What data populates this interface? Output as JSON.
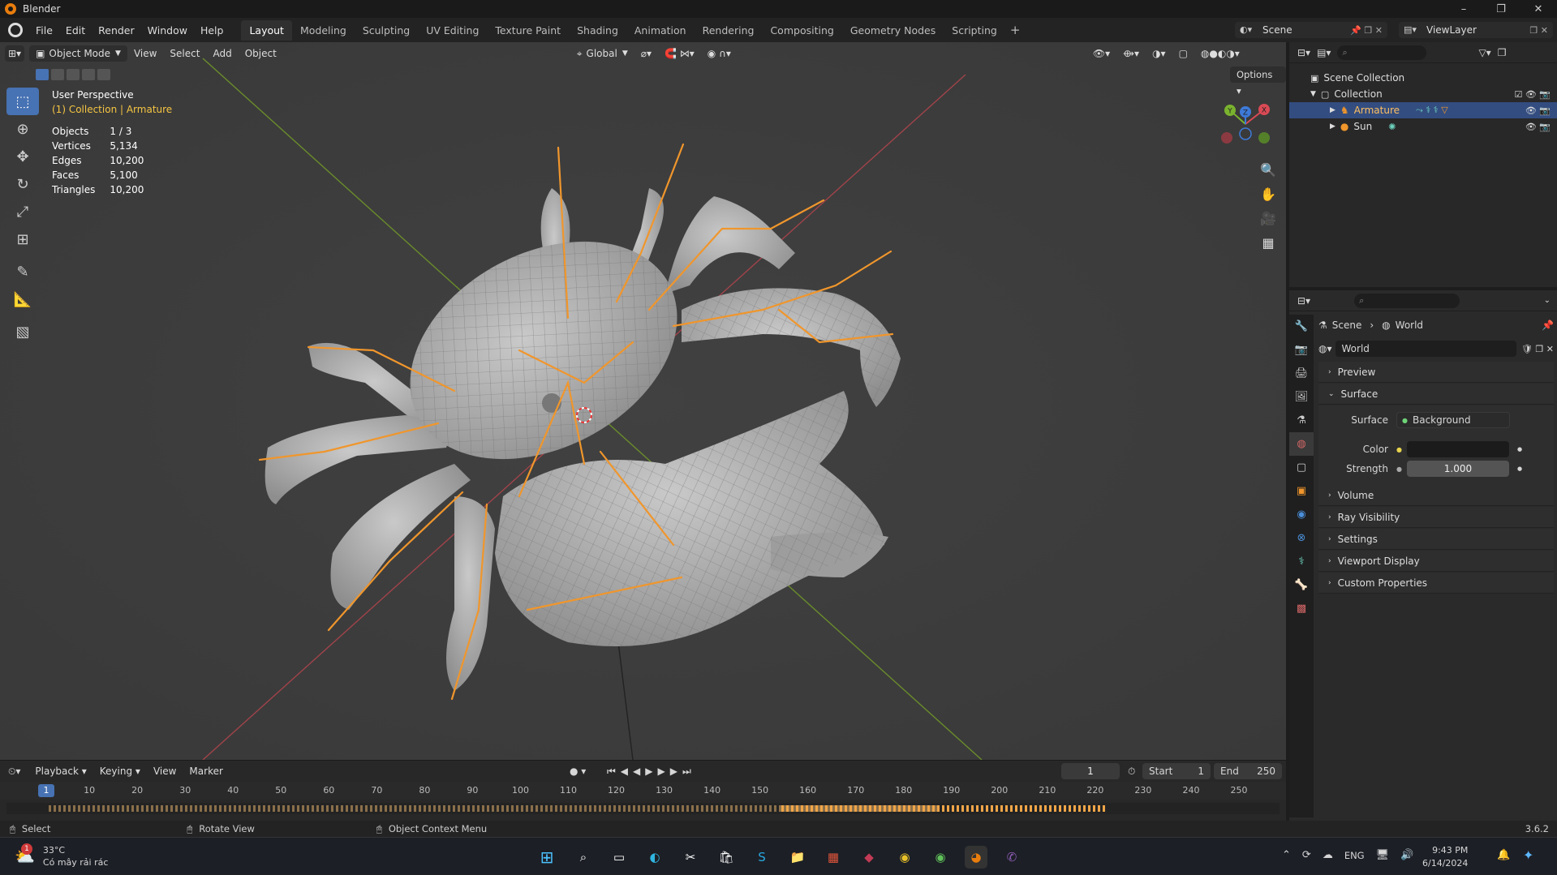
{
  "window": {
    "title": "Blender",
    "controls": [
      "–",
      "❐",
      "✕"
    ]
  },
  "menubar": {
    "menus": [
      "File",
      "Edit",
      "Render",
      "Window",
      "Help"
    ],
    "tabs": [
      "Layout",
      "Modeling",
      "Sculpting",
      "UV Editing",
      "Texture Paint",
      "Shading",
      "Animation",
      "Rendering",
      "Compositing",
      "Geometry Nodes",
      "Scripting"
    ],
    "active_tab": "Layout",
    "add_tab": "+",
    "scene": "Scene",
    "view_layer": "ViewLayer"
  },
  "viewport": {
    "mode": "Object Mode",
    "menus": [
      "View",
      "Select",
      "Add",
      "Object"
    ],
    "orientation": "Global",
    "options": "Options",
    "perspective_label": "User Perspective",
    "collection_label": "(1) Collection | Armature",
    "stats": [
      {
        "label": "Objects",
        "value": "1 / 3"
      },
      {
        "label": "Vertices",
        "value": "5,134"
      },
      {
        "label": "Edges",
        "value": "10,200"
      },
      {
        "label": "Faces",
        "value": "5,100"
      },
      {
        "label": "Triangles",
        "value": "10,200"
      }
    ],
    "gizmo_axes": {
      "x": "X",
      "y": "Y",
      "z": "Z"
    }
  },
  "outliner": {
    "scene_collection": "Scene Collection",
    "collection": "Collection",
    "items": [
      "Armature",
      "Sun"
    ]
  },
  "properties": {
    "breadcrumb_scene": "Scene",
    "breadcrumb_world": "World",
    "world_name": "World",
    "panels": {
      "preview": "Preview",
      "surface": "Surface",
      "volume": "Volume",
      "ray_visibility": "Ray Visibility",
      "settings": "Settings",
      "viewport_display": "Viewport Display",
      "custom_properties": "Custom Properties"
    },
    "surface_label": "Surface",
    "surface_value": "Background",
    "color_label": "Color",
    "strength_label": "Strength",
    "strength_value": "1.000"
  },
  "timeline": {
    "menus": [
      "Playback",
      "Keying",
      "View",
      "Marker"
    ],
    "current_frame": "1",
    "start_label": "Start",
    "start_value": "1",
    "end_label": "End",
    "end_value": "250",
    "ticks": [
      "10",
      "20",
      "30",
      "40",
      "50",
      "60",
      "70",
      "80",
      "90",
      "100",
      "110",
      "120",
      "130",
      "140",
      "150",
      "160",
      "170",
      "180",
      "190",
      "200",
      "210",
      "220",
      "230",
      "240",
      "250"
    ],
    "playhead_label": "1"
  },
  "statusbar": {
    "select": "Select",
    "rotate": "Rotate View",
    "context": "Object Context Menu",
    "version": "3.6.2"
  },
  "taskbar": {
    "weather_temp": "33°C",
    "weather_desc": "Có mây rải rác",
    "badge": "1",
    "lang": "ENG",
    "time": "9:43 PM",
    "date": "6/14/2024"
  },
  "colors": {
    "accent": "#4772b3",
    "bone": "#f0962c",
    "selected_row": "#334d80"
  }
}
